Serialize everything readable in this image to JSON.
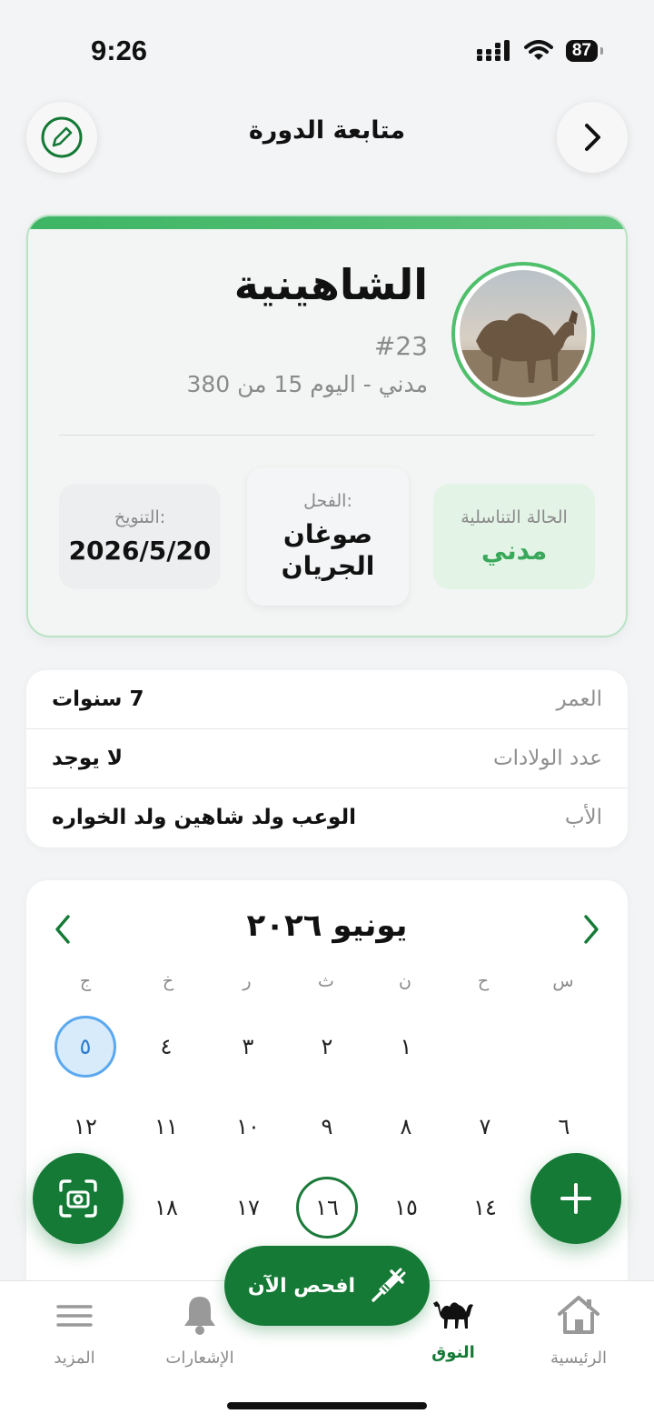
{
  "status_bar": {
    "time": "9:26",
    "battery": "87"
  },
  "header": {
    "title": "متابعة الدورة",
    "edit_icon": "pencil-circle-icon",
    "back_icon": "chevron-right-icon"
  },
  "camel": {
    "name": "الشاهينية",
    "id": "#23",
    "subtitle": "مدني - اليوم 15 من 380",
    "photo_icon": "camel-photo"
  },
  "info_boxes": {
    "status": {
      "label": "الحالة التناسلية",
      "value": "مدني"
    },
    "sire": {
      "label": "الفحل:",
      "value_line1": "صوغان",
      "value_line2": "الجريان"
    },
    "insemination": {
      "label": "التنويخ:",
      "value": "2026/5/20"
    }
  },
  "details": [
    {
      "label": "العمر",
      "value": "7 سنوات"
    },
    {
      "label": "عدد الولادات",
      "value": "لا يوجد"
    },
    {
      "label": "الأب",
      "value": "الوعب ولد شاهين ولد الخواره"
    }
  ],
  "calendar": {
    "title": "يونيو ٢٠٢٦",
    "weekdays": [
      "س",
      "ح",
      "ن",
      "ث",
      "ر",
      "خ",
      "ج"
    ],
    "week1": [
      "",
      "",
      "١",
      "٢",
      "٣",
      "٤",
      "٥"
    ],
    "week2": [
      "٦",
      "٧",
      "٨",
      "٩",
      "١٠",
      "١١",
      "١٢"
    ],
    "week3": [
      "",
      "١٤",
      "١٥",
      "١٦",
      "١٧",
      "١٨",
      ""
    ],
    "today": "٥",
    "marked": "١٦"
  },
  "fabs": {
    "add_icon": "plus-icon",
    "scan_icon": "camera-scan-icon"
  },
  "check_button": {
    "label": "افحص الآن",
    "icon": "syringe-icon"
  },
  "bottom_nav": [
    {
      "label": "الرئيسية",
      "icon": "home-icon"
    },
    {
      "label": "النوق",
      "icon": "camel-icon"
    },
    {
      "label": "الإشعارات",
      "icon": "bell-icon"
    },
    {
      "label": "المزيد",
      "icon": "menu-icon"
    }
  ],
  "colors": {
    "accent": "#157a36",
    "accent_light": "#4fbf6b",
    "today_blue": "#5aa8ee"
  }
}
